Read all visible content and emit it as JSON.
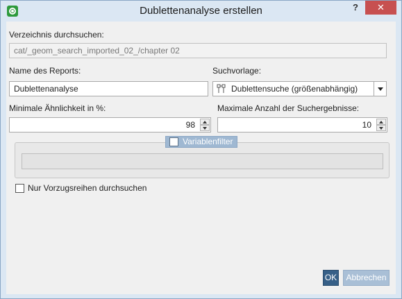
{
  "window": {
    "title": "Dublettenanalyse erstellen",
    "help_label": "?",
    "close_label": "✕"
  },
  "directory": {
    "label": "Verzeichnis durchsuchen:",
    "value": "cat/_geom_search_imported_02_/chapter 02"
  },
  "report_name": {
    "label": "Name des Reports:",
    "value": "Dublettenanalyse"
  },
  "search_template": {
    "label": "Suchvorlage:",
    "value": "Dublettensuche (größenabhängig)"
  },
  "min_similarity": {
    "label": "Minimale Ähnlichkeit in %:",
    "value": "98"
  },
  "max_results": {
    "label": "Maximale Anzahl der Suchergebnisse:",
    "value": "10"
  },
  "variable_filter": {
    "label": "Variablenfilter",
    "checked": false,
    "value": ""
  },
  "preferred_series": {
    "label": "Nur Vorzugsreihen durchsuchen",
    "checked": false
  },
  "buttons": {
    "ok": "OK",
    "cancel": "Abbrechen"
  },
  "colors": {
    "accent": "#365f87",
    "titlebar": "#dbe7f3",
    "close": "#c75050",
    "group_header": "#9fb8d2"
  },
  "icons": {
    "app": "app-logo-icon",
    "template": "duplicate-search-icon"
  }
}
